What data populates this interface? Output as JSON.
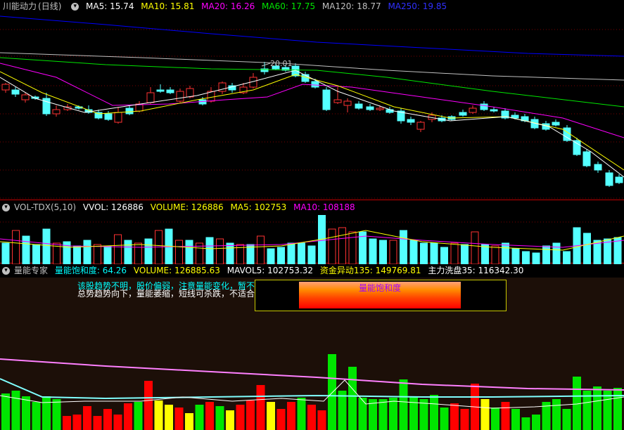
{
  "main": {
    "title": "川能动力",
    "period": "(日线)",
    "ma5": "MA5: 15.74",
    "ma10": "MA10: 15.81",
    "ma20": "MA20: 16.26",
    "ma60": "MA60: 17.75",
    "ma120": "MA120: 18.77",
    "ma250": "MA250: 19.85",
    "high_marker": "20.01"
  },
  "volume_panel": {
    "name": "VOL-TDX(5,10)",
    "vvol": "VVOL: 126886",
    "volume": "VOLUME: 126886",
    "ma5": "MA5: 102753",
    "ma10": "MA10: 108188"
  },
  "expert_panel": {
    "name": "量能专家",
    "saturation": "量能饱和度: 64.26",
    "volume": "VOLUME: 126885.63",
    "mavol5": "MAVOL5: 102753.32",
    "fund_anomaly": "资金异动135: 149769.81",
    "main_wash": "主力洗盘35: 116342.30",
    "note_line1": "该股趋势不明，股价偏弱，注意量能变化，暂不参与。",
    "note_line2": "总势趋势向下，量能萎缩，短线可杀跌，不适合进场。",
    "gauge_label": "量能饱和度"
  },
  "colors": {
    "up": "#ff3232",
    "down": "#54ffff",
    "ma5": "#ffffff",
    "ma10": "#ffff00",
    "ma20": "#ff00ff",
    "ma60": "#00e600",
    "ma120": "#c0c0c0",
    "ma250": "#0000ff"
  },
  "icons": [
    "chevron-down-icon"
  ]
}
